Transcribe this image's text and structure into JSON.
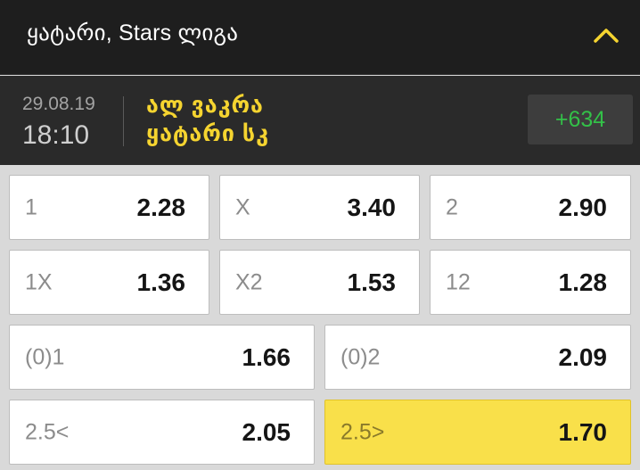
{
  "header": {
    "title": "ყატარი, Stars ლიგა"
  },
  "match": {
    "date": "29.08.19",
    "time": "18:10",
    "team_home": "ალ ვაკრა",
    "team_away": "ყატარი სკ",
    "more_markets": "+634"
  },
  "odds": [
    {
      "label": "1",
      "odd": "2.28",
      "selected": false
    },
    {
      "label": "X",
      "odd": "3.40",
      "selected": false
    },
    {
      "label": "2",
      "odd": "2.90",
      "selected": false
    },
    {
      "label": "1X",
      "odd": "1.36",
      "selected": false
    },
    {
      "label": "X2",
      "odd": "1.53",
      "selected": false
    },
    {
      "label": "12",
      "odd": "1.28",
      "selected": false
    },
    {
      "label": "(0)1",
      "odd": "1.66",
      "selected": false
    },
    {
      "label": "(0)2",
      "odd": "2.09",
      "selected": false
    },
    {
      "label": "2.5<",
      "odd": "2.05",
      "selected": false
    },
    {
      "label": "2.5>",
      "odd": "1.70",
      "selected": true
    }
  ],
  "colors": {
    "accent_yellow": "#f5d430",
    "selected_bg": "#f9e04a",
    "more_green": "#33c048",
    "header_bg": "#1e1e1e"
  },
  "icons": {
    "collapse": "chevron-up-icon"
  }
}
